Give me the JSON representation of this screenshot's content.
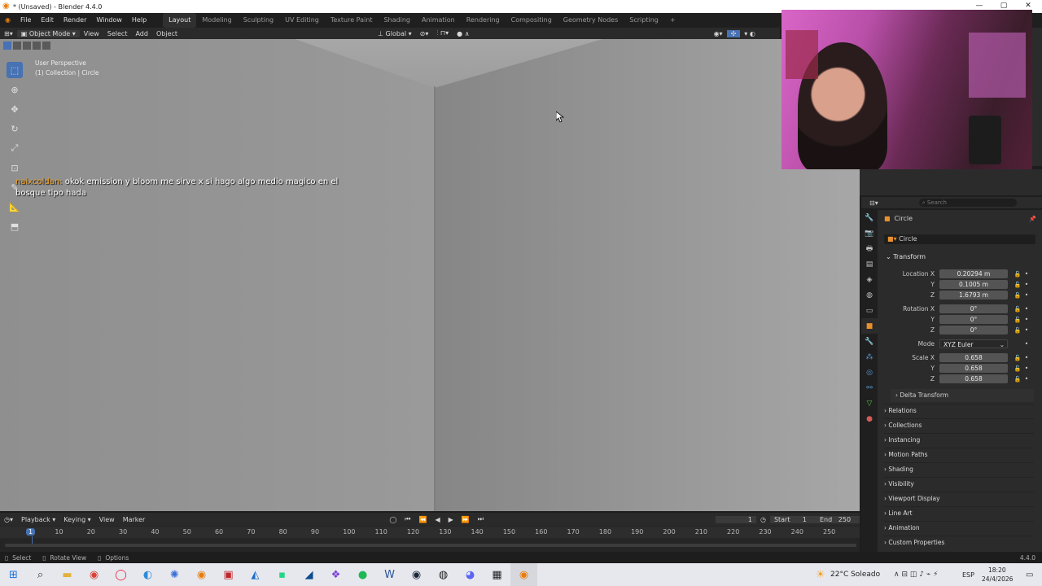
{
  "window": {
    "title": "* (Unsaved) - Blender 4.4.0"
  },
  "menubar": {
    "menus": [
      "File",
      "Edit",
      "Render",
      "Window",
      "Help"
    ],
    "workspaces": [
      "Layout",
      "Modeling",
      "Sculpting",
      "UV Editing",
      "Texture Paint",
      "Shading",
      "Animation",
      "Rendering",
      "Compositing",
      "Geometry Nodes",
      "Scripting"
    ],
    "add_tab": "+"
  },
  "viewport_header": {
    "mode": "Object Mode",
    "menus": [
      "View",
      "Select",
      "Add",
      "Object"
    ],
    "transform_orientation": "Global"
  },
  "viewport": {
    "perspective": "User Perspective",
    "collection": "(1) Collection | Circle"
  },
  "chat": {
    "user": "naixcoldan:",
    "message": " okok emission y bloom me sirve x si hago algo medio magico en el bosque tipo hada"
  },
  "properties": {
    "search_placeholder": "Search",
    "object_name": "Circle",
    "object_field": "Circle",
    "transform_header": "Transform",
    "location_label": "Location X",
    "location": [
      "0.20294 m",
      "0.1005 m",
      "1.6793 m"
    ],
    "rotation_label": "Rotation X",
    "rotation": [
      "0°",
      "0°",
      "0°"
    ],
    "mode_label": "Mode",
    "mode_value": "XYZ Euler",
    "scale_label": "Scale X",
    "scale": [
      "0.658",
      "0.658",
      "0.658"
    ],
    "axis_y": "Y",
    "axis_z": "Z",
    "delta_transform": "Delta Transform",
    "sections": [
      "Relations",
      "Collections",
      "Instancing",
      "Motion Paths",
      "Shading",
      "Visibility",
      "Viewport Display",
      "Line Art",
      "Animation",
      "Custom Properties"
    ]
  },
  "timeline": {
    "menus": [
      "Playback",
      "Keying",
      "View",
      "Marker"
    ],
    "current_frame": "1",
    "start_label": "Start",
    "start": "1",
    "end_label": "End",
    "end": "250",
    "ticks": [
      "1",
      "10",
      "20",
      "30",
      "40",
      "50",
      "60",
      "70",
      "80",
      "90",
      "100",
      "110",
      "120",
      "130",
      "140",
      "150",
      "160",
      "170",
      "180",
      "190",
      "200",
      "210",
      "220",
      "230",
      "240",
      "250"
    ]
  },
  "statusbar": {
    "select": "Select",
    "rotate_view": "Rotate View",
    "options": "Options",
    "version": "4.4.0"
  },
  "taskbar": {
    "weather": "22°C  Soleado",
    "lang": "ESP",
    "time": "18:20",
    "date": "24/4/2026"
  }
}
